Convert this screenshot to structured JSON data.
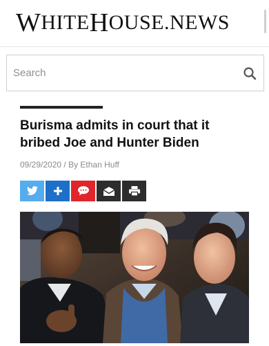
{
  "site": {
    "logo_first": "W",
    "logo_rest1": "HITE",
    "logo_h": "H",
    "logo_rest2": "OUSE.NEWS"
  },
  "search": {
    "placeholder": "Search"
  },
  "article": {
    "title": "Burisma admits in court that it bribed Joe and Hunter Biden",
    "date": "09/29/2020",
    "separator": " / By ",
    "author": "Ethan Huff"
  },
  "share": {
    "colors": {
      "twitter": "#55acee",
      "plus": "#1e6fc8",
      "comment": "#e0262b",
      "email": "#2d2d2d",
      "print": "#2d2d2d"
    }
  },
  "photo": {
    "subject": "Barack Obama, Joe Biden and Hunter Biden at a basketball game"
  }
}
